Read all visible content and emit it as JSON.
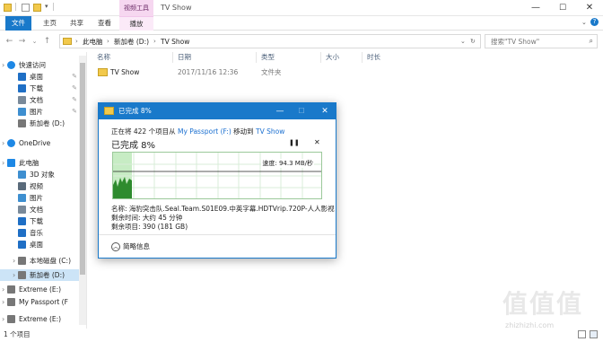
{
  "titlebar": {
    "context_tab": "视频工具",
    "title": "TV Show",
    "controls": [
      "—",
      "☐",
      "✕"
    ]
  },
  "ribbon": {
    "tabs": [
      "文件",
      "主页",
      "共享",
      "查看",
      "播放"
    ]
  },
  "address": {
    "crumbs": [
      "此电脑",
      "新加卷 (D:)",
      "TV Show"
    ],
    "search_placeholder": "搜索\"TV Show\""
  },
  "sidebar": {
    "items": [
      {
        "label": "快速访问",
        "icon": "star-icon",
        "color": "#1e88e5"
      },
      {
        "label": "桌面",
        "icon": "desktop-icon",
        "color": "#1f6fc5",
        "pin": true
      },
      {
        "label": "下载",
        "icon": "download-icon",
        "color": "#1f6fc5",
        "pin": true
      },
      {
        "label": "文档",
        "icon": "document-icon",
        "color": "#7a8a9a",
        "pin": true
      },
      {
        "label": "图片",
        "icon": "picture-icon",
        "color": "#3e8fd0",
        "pin": true
      },
      {
        "label": "新加卷 (D:)",
        "icon": "drive-icon",
        "color": "#777777"
      },
      {
        "label": "OneDrive",
        "icon": "cloud-icon",
        "color": "#1e88e5"
      },
      {
        "label": "此电脑",
        "icon": "computer-icon",
        "color": "#1e88e5"
      },
      {
        "label": "3D 对象",
        "icon": "cube-icon",
        "color": "#3e8fd0"
      },
      {
        "label": "视频",
        "icon": "video-icon",
        "color": "#5a6b7b"
      },
      {
        "label": "图片",
        "icon": "picture-icon",
        "color": "#3e8fd0"
      },
      {
        "label": "文档",
        "icon": "document-icon",
        "color": "#7a8a9a"
      },
      {
        "label": "下载",
        "icon": "download-icon",
        "color": "#1f6fc5"
      },
      {
        "label": "音乐",
        "icon": "music-icon",
        "color": "#1f6fc5"
      },
      {
        "label": "桌面",
        "icon": "desktop-icon",
        "color": "#1f6fc5"
      },
      {
        "label": "本地磁盘 (C:)",
        "icon": "drive-icon",
        "color": "#777777"
      },
      {
        "label": "新加卷 (D:)",
        "icon": "drive-icon",
        "color": "#777777",
        "selected": true
      },
      {
        "label": "Extreme (E:)",
        "icon": "drive-icon",
        "color": "#777777"
      },
      {
        "label": "My Passport (F",
        "icon": "drive-icon",
        "color": "#777777"
      },
      {
        "label": "Extreme (E:)",
        "icon": "drive-icon",
        "color": "#777777"
      }
    ]
  },
  "columns": [
    "名称",
    "日期",
    "类型",
    "大小",
    "时长"
  ],
  "files": [
    {
      "name": "TV Show",
      "date": "2017/11/16 12:36",
      "type": "文件夹"
    }
  ],
  "status": "1 个项目",
  "dialog": {
    "title": "已完成 8%",
    "line_prefix": "正在将 422 个项目从",
    "source": "My Passport (F:)",
    "line_mid": "移动到",
    "dest": "TV Show",
    "heading": "已完成 8%",
    "pause": "❚❚",
    "close": "✕",
    "speed": "速度: 94.3 MB/秒",
    "name_line": "名称: 海豹突击队.Seal.Team.S01E09.中英字幕.HDTVrip.720P-人人影视",
    "time_line": "剩余时间: 大约 45 分钟",
    "items_line": "剩余项目: 390 (181 GB)",
    "details_label": "简略信息",
    "accent": "#1979ca",
    "graph_fill": "#2e8b2e"
  },
  "watermark": {
    "text": "值值值",
    "sub": "zhizhizhi.com"
  }
}
